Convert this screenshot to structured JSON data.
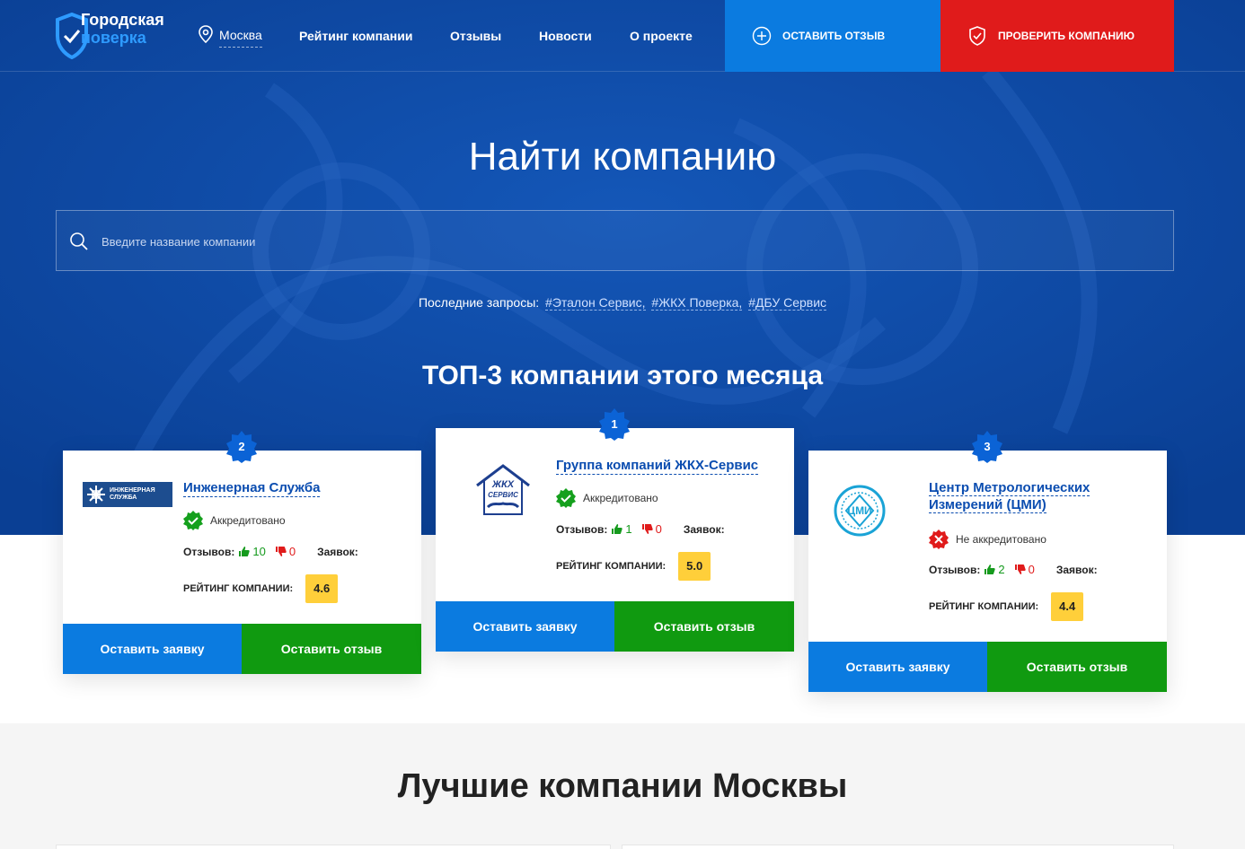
{
  "header": {
    "logo_line1": "Городская",
    "logo_line2": "поверка",
    "city": "Москва",
    "nav": [
      "Рейтинг компании",
      "Отзывы",
      "Новости",
      "О проекте"
    ],
    "btn_review": "ОСТАВИТЬ ОТЗЫВ",
    "btn_check": "ПРОВЕРИТЬ КОМПАНИЮ"
  },
  "search": {
    "title": "Найти компанию",
    "placeholder": "Введите название компании",
    "recent_label": "Последние запросы:",
    "recent_tags": [
      "#Эталон Сервис,",
      "#ЖКХ Поверка,",
      "#ДБУ Сервис"
    ]
  },
  "top3": {
    "title": "ТОП-3 компании этого месяца",
    "labels": {
      "reviews": "Отзывов:",
      "applications": "Заявок:",
      "rating": "РЕЙТИНГ КОМПАНИИ:",
      "leave_request": "Оставить заявку",
      "leave_review": "Оставить отзыв"
    },
    "cards": [
      {
        "rank": "2",
        "name": "Инженерная Служба",
        "logo_text1": "ИНЖЕНЕРНАЯ",
        "logo_text2": "СЛУЖБА",
        "status": "Аккредитовано",
        "likes": "10",
        "dislikes": "0",
        "rating": "4.6"
      },
      {
        "rank": "1",
        "name": "Группа компаний ЖКХ-Сервис",
        "logo_text1": "ЖКХ",
        "logo_text2": "СЕРВИС",
        "status": "Аккредитовано",
        "likes": "1",
        "dislikes": "0",
        "rating": "5.0"
      },
      {
        "rank": "3",
        "name": "Центр Метрологических Измерений (ЦМИ)",
        "logo_text1": "ЦМИ",
        "status": "Не аккредитовано",
        "likes": "2",
        "dislikes": "0",
        "rating": "4.4"
      }
    ]
  },
  "best": {
    "title": "Лучшие компании Москвы"
  },
  "colors": {
    "hero_bg": "#0c4aa6",
    "review_btn": "#0b7be0",
    "check_btn": "#e01b1b",
    "green": "#109a10",
    "rating_bg": "#ffcf3a"
  }
}
